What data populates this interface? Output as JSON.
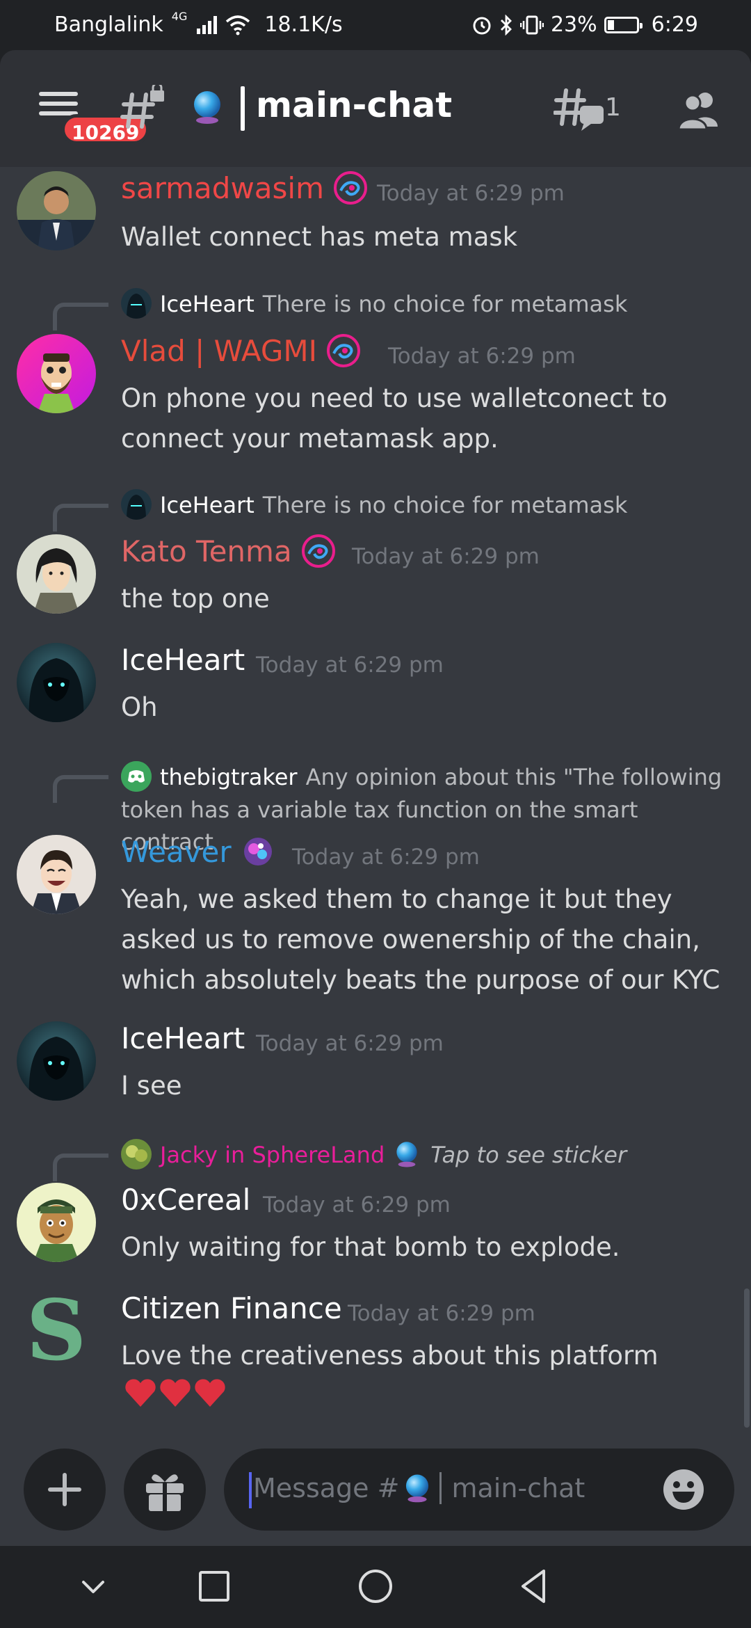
{
  "status_bar": {
    "carrier": "Banglalink",
    "network": "4G",
    "speed": "18.1K/s",
    "battery_percent": "23%",
    "battery_level": 0.23,
    "time": "6:29"
  },
  "header": {
    "unread_badge": "10269",
    "channel_name": "main-chat",
    "threads_count": "1"
  },
  "messages": [
    {
      "author": "sarmadwasim",
      "author_color": "#f04747",
      "time": "Today at 6:29 pm",
      "text": "Wallet connect has meta mask"
    },
    {
      "reply_author": "IceHeart",
      "reply_text": "There is no choice for metamask",
      "author": "Vlad | WAGMI",
      "author_color": "#e74c3c",
      "time": "Today at 6:29 pm",
      "text": "On phone you need to use walletconect to connect your metamask app."
    },
    {
      "reply_author": "IceHeart",
      "reply_text": "There is no choice for metamask",
      "author": "Kato Tenma",
      "author_color": "#e06666",
      "time": "Today at 6:29 pm",
      "text": "the top one"
    },
    {
      "author": "IceHeart",
      "author_color": "#ffffff",
      "time": "Today at 6:29 pm",
      "text": "Oh"
    },
    {
      "reply_author": "thebigtraker",
      "reply_text_1": "Any opinion about this \"The following",
      "reply_text_2": "token has a variable tax function on the smart contract",
      "author": "Weaver",
      "author_color": "#3498db",
      "time": "Today at 6:29 pm",
      "text": "Yeah, we asked them to change it but they asked us to remove owenership of the chain, which absolutely beats the purpose of our KYC"
    },
    {
      "author": "IceHeart",
      "author_color": "#ffffff",
      "time": "Today at 6:29 pm",
      "text": "I see"
    },
    {
      "reply_author": "Jacky in SphereLand",
      "reply_author_color": "#e91e9a",
      "reply_text": "Tap to see sticker",
      "author": "0xCereal",
      "author_color": "#ffffff",
      "time": "Today at 6:29 pm",
      "text": "Only waiting for that bomb to explode."
    },
    {
      "author": "Citizen Finance",
      "author_color": "#ffffff",
      "time": "Today at 6:29 pm",
      "text": "Love the creativeness about this platform",
      "avatar_letter": "S",
      "hearts": "❤️❤️❤️"
    }
  ],
  "input": {
    "placeholder_prefix": "Message #",
    "placeholder_channel": "main-chat"
  },
  "icons": {
    "menu": "hamburger-icon",
    "channel": "locked-hash-icon",
    "threads": "threads-icon",
    "members": "members-icon",
    "add": "plus-icon",
    "gift": "gift-icon",
    "emoji": "smile-icon"
  }
}
